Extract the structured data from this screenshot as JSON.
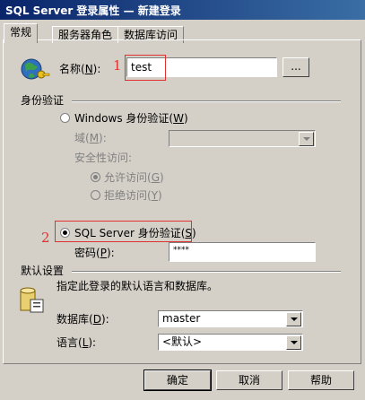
{
  "window": {
    "title": "SQL Server 登录属性 — 新建登录"
  },
  "tabs": [
    {
      "label": "常规"
    },
    {
      "label": "服务器角色"
    },
    {
      "label": "数据库访问"
    }
  ],
  "general": {
    "name_label": "名称(N):",
    "name_value": "test",
    "browse_label": "...",
    "auth_group": "身份验证",
    "windows_auth_label": "Windows 身份验证(W)",
    "domain_label": "域(M):",
    "security_access_label": "安全性访问:",
    "allow_label": "允许访问(G)",
    "deny_label": "拒绝访问(Y)",
    "sql_auth_label": "SQL Server 身份验证(S)",
    "password_label": "密码(P):",
    "password_value": "****",
    "defaults_group": "默认设置",
    "defaults_desc": "指定此登录的默认语言和数据库。",
    "database_label": "数据库(D):",
    "database_value": "master",
    "language_label": "语言(L):",
    "language_value": "<默认>"
  },
  "annotations": {
    "one": "1",
    "two": "2"
  },
  "buttons": {
    "ok": "确定",
    "cancel": "取消",
    "help": "帮助"
  },
  "colors": {
    "face": "#d4d0c8",
    "titlebar": "#0a246a",
    "annotation": "#e03030"
  }
}
